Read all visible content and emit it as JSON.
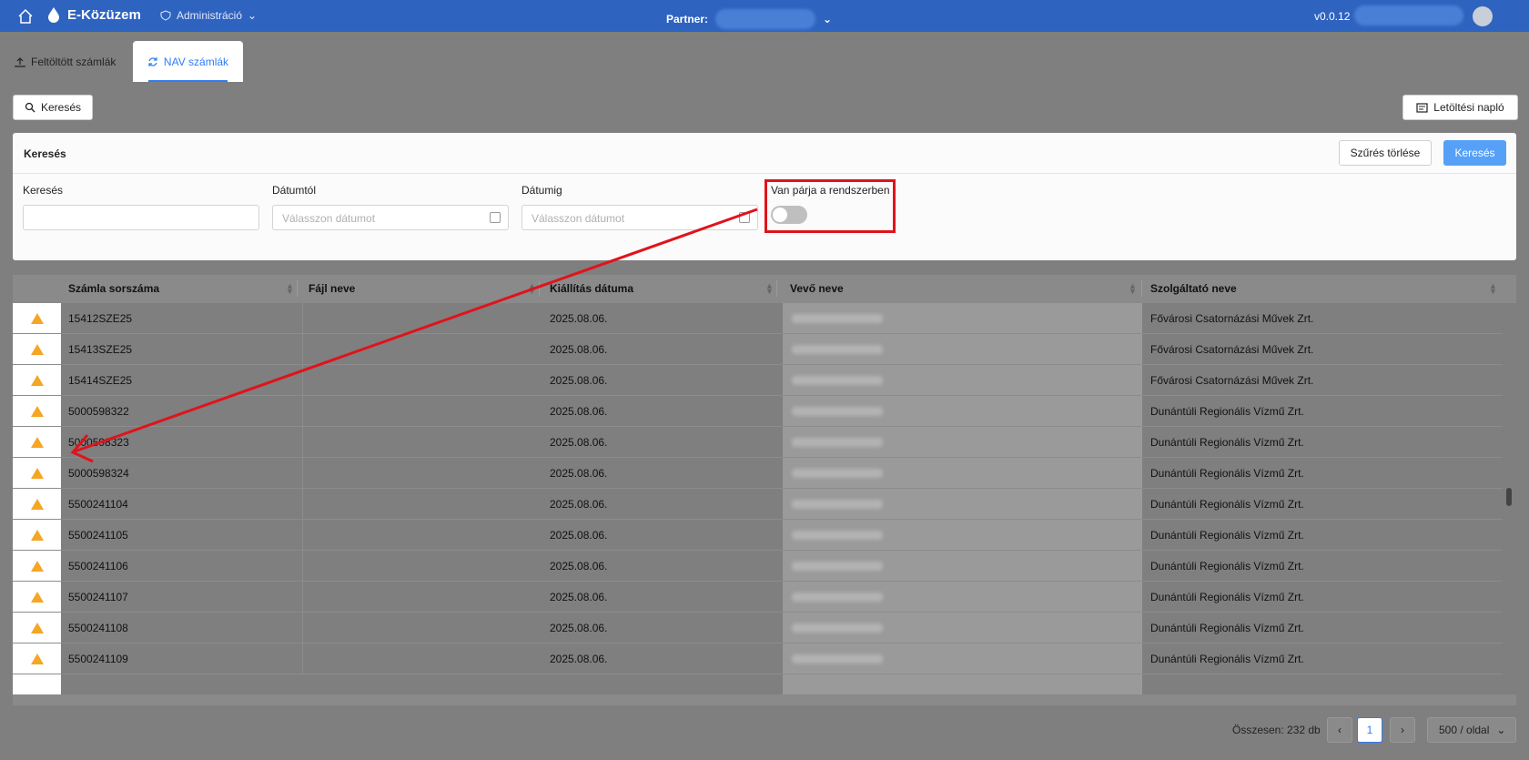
{
  "header": {
    "app_name": "E-Közüzem",
    "admin_label": "Administráció",
    "partner_label": "Partner:",
    "version": "v0.0.12"
  },
  "tabs": [
    {
      "label": "Feltöltött számlák",
      "icon": "upload-icon"
    },
    {
      "label": "NAV számlák",
      "icon": "sync-icon"
    }
  ],
  "toolbar": {
    "search_label": "Keresés",
    "download_log_label": "Letöltési napló"
  },
  "search_panel": {
    "title": "Keresés",
    "clear_label": "Szűrés törlése",
    "search_label": "Keresés",
    "fields": [
      {
        "label": "Keresés",
        "placeholder": ""
      },
      {
        "label": "Dátumtól",
        "placeholder": "Válasszon dátumot"
      },
      {
        "label": "Dátumig",
        "placeholder": "Válasszon dátumot"
      }
    ],
    "toggle_label": "Van párja a rendszerben",
    "toggle_on": false
  },
  "table": {
    "columns": [
      "Számla sorszáma",
      "Fájl neve",
      "Kiállítás dátuma",
      "Vevő neve",
      "Szolgáltató neve"
    ],
    "rows": [
      {
        "number": "15412SZE25",
        "date": "2025.08.06.",
        "provider": "Fővárosi Csatornázási Művek Zrt."
      },
      {
        "number": "15413SZE25",
        "date": "2025.08.06.",
        "provider": "Fővárosi Csatornázási Művek Zrt."
      },
      {
        "number": "15414SZE25",
        "date": "2025.08.06.",
        "provider": "Fővárosi Csatornázási Művek Zrt."
      },
      {
        "number": "5000598322",
        "date": "2025.08.06.",
        "provider": "Dunántúli Regionális Vízmű Zrt."
      },
      {
        "number": "5000598323",
        "date": "2025.08.06.",
        "provider": "Dunántúli Regionális Vízmű Zrt."
      },
      {
        "number": "5000598324",
        "date": "2025.08.06.",
        "provider": "Dunántúli Regionális Vízmű Zrt."
      },
      {
        "number": "5500241104",
        "date": "2025.08.06.",
        "provider": "Dunántúli Regionális Vízmű Zrt."
      },
      {
        "number": "5500241105",
        "date": "2025.08.06.",
        "provider": "Dunántúli Regionális Vízmű Zrt."
      },
      {
        "number": "5500241106",
        "date": "2025.08.06.",
        "provider": "Dunántúli Regionális Vízmű Zrt."
      },
      {
        "number": "5500241107",
        "date": "2025.08.06.",
        "provider": "Dunántúli Regionális Vízmű Zrt."
      },
      {
        "number": "5500241108",
        "date": "2025.08.06.",
        "provider": "Dunántúli Regionális Vízmű Zrt."
      },
      {
        "number": "5500241109",
        "date": "2025.08.06.",
        "provider": "Dunántúli Regionális Vízmű Zrt."
      }
    ]
  },
  "pagination": {
    "total": "Összesen: 232 db",
    "page": "1",
    "page_size": "500 / oldal"
  },
  "colors": {
    "header_bg": "#2f63c0",
    "accent": "#2f7df6",
    "warning": "#f5a623",
    "annotation": "#e0131b"
  }
}
